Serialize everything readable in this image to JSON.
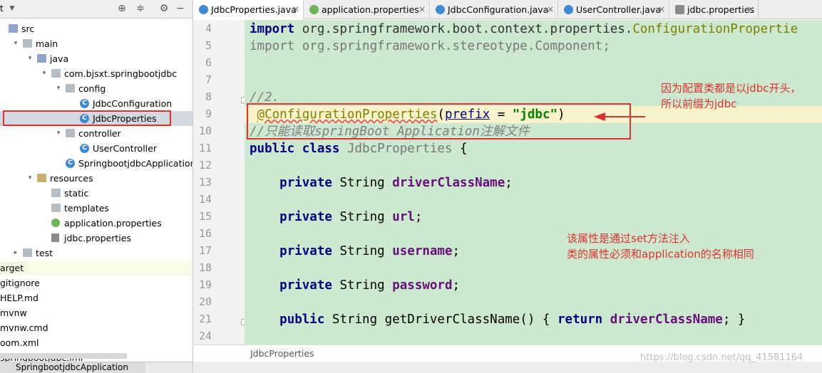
{
  "project": {
    "header_label": "t",
    "tree": [
      {
        "label": "src",
        "indent": 0,
        "arrow": "",
        "icon": "src"
      },
      {
        "label": "main",
        "indent": 1,
        "arrow": "▾",
        "icon": "folder"
      },
      {
        "label": "java",
        "indent": 2,
        "arrow": "▾",
        "icon": "src"
      },
      {
        "label": "com.bjsxt.springbootjdbc",
        "indent": 3,
        "arrow": "▾",
        "icon": "folder"
      },
      {
        "label": "config",
        "indent": 4,
        "arrow": "▾",
        "icon": "folder"
      },
      {
        "label": "JdbcConfiguration",
        "indent": 5,
        "arrow": "",
        "icon": "class"
      },
      {
        "label": "JdbcProperties",
        "indent": 5,
        "arrow": "",
        "icon": "class"
      },
      {
        "label": "controller",
        "indent": 4,
        "arrow": "▾",
        "icon": "folder"
      },
      {
        "label": "UserController",
        "indent": 5,
        "arrow": "",
        "icon": "class"
      },
      {
        "label": "SpringbootjdbcApplication",
        "indent": 4,
        "arrow": "",
        "icon": "class"
      },
      {
        "label": "resources",
        "indent": 2,
        "arrow": "▾",
        "icon": "res"
      },
      {
        "label": "static",
        "indent": 3,
        "arrow": "",
        "icon": "folder"
      },
      {
        "label": "templates",
        "indent": 3,
        "arrow": "",
        "icon": "folder"
      },
      {
        "label": "application.properties",
        "indent": 3,
        "arrow": "",
        "icon": "leaf"
      },
      {
        "label": "jdbc.properties",
        "indent": 3,
        "arrow": "",
        "icon": "prop"
      },
      {
        "label": "test",
        "indent": 1,
        "arrow": "▸",
        "icon": "folder"
      },
      {
        "label": "arget",
        "indent": 0,
        "arrow": "",
        "icon": "none"
      },
      {
        "label": "gitignore",
        "indent": 0,
        "arrow": "",
        "icon": "none"
      },
      {
        "label": "HELP.md",
        "indent": 0,
        "arrow": "",
        "icon": "none"
      },
      {
        "label": "mvnw",
        "indent": 0,
        "arrow": "",
        "icon": "none"
      },
      {
        "label": "mvnw.cmd",
        "indent": 0,
        "arrow": "",
        "icon": "none"
      },
      {
        "label": "oom.xml",
        "indent": 0,
        "arrow": "",
        "icon": "none"
      },
      {
        "label": "springbootjdbc.iml",
        "indent": 0,
        "arrow": "",
        "icon": "none"
      }
    ],
    "run_tab": "SpringbootjdbcApplication"
  },
  "tabs": [
    {
      "label": "JdbcProperties.java",
      "icon": "j",
      "active": true
    },
    {
      "label": "application.properties",
      "icon": "p",
      "active": false
    },
    {
      "label": "JdbcConfiguration.java",
      "icon": "j",
      "active": false
    },
    {
      "label": "UserController.java",
      "icon": "j",
      "active": false
    },
    {
      "label": "jdbc.properties",
      "icon": "f",
      "active": false
    }
  ],
  "editor": {
    "line_numbers": [
      "4",
      "5",
      "6",
      "7",
      "8",
      "9",
      "10",
      "11",
      "12",
      "13",
      "14",
      "15",
      "16",
      "17",
      "18",
      "19",
      "20",
      "21",
      "24"
    ],
    "code": {
      "l4_kw": "import",
      "l4_pkg": " org.springframework.boot.context.properties.",
      "l4_cls": "ConfigurationPropertie",
      "l5_kw": "import",
      "l5_pkg": " org.springframework.stereotype.Component;",
      "l8": "//2.",
      "l9_ann": "@ConfigurationProperties",
      "l9_open": "(",
      "l9_attr": "prefix",
      "l9_eq": " = ",
      "l9_str": "\"jdbc\"",
      "l9_close": ")",
      "l10": "//只能读取springBoot Application注解文件",
      "l11_kw": "public class",
      "l11_name": " JdbcProperties",
      "l11_brace": " {",
      "l13_kw": "private",
      "l13_type": " String ",
      "l13_fld": "driverClassName",
      "l15_fld": "url",
      "l17_fld": "username",
      "l19_fld": "password",
      "l21_kw": "public",
      "l21_sig": " String getDriverClassName() ",
      "l21_open": "{",
      "l21_ret": " return ",
      "l21_fld": "driverClassName",
      "l21_end": "; }",
      "semicolon": ";"
    },
    "breadcrumb": "JdbcProperties"
  },
  "annotations": {
    "note1_line1": "因为配置类都是以jdbc开头，",
    "note1_line2": "所以前缀为jdbc",
    "note2_line1": "该属性是通过set方法注入",
    "note2_line2": "类的属性必须和application的名称相同",
    "color": "#e0322d"
  },
  "watermark": "https://blog.csdn.net/qq_41581164"
}
